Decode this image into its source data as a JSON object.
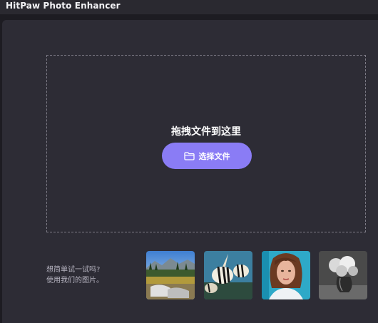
{
  "window": {
    "title": "HitPaw Photo Enhancer"
  },
  "dropzone": {
    "title": "拖拽文件到这里",
    "choose_button_label": "选择文件",
    "choose_button_icon": "folder-icon",
    "accent_color": "#8a7cf5"
  },
  "samples": {
    "prompt_line1": "想简单试一试吗?",
    "prompt_line2": "使用我们的图片。",
    "images": [
      {
        "subject": "landscape-photo"
      },
      {
        "subject": "fish-photo"
      },
      {
        "subject": "portrait-photo"
      },
      {
        "subject": "flowers-photo"
      }
    ]
  }
}
